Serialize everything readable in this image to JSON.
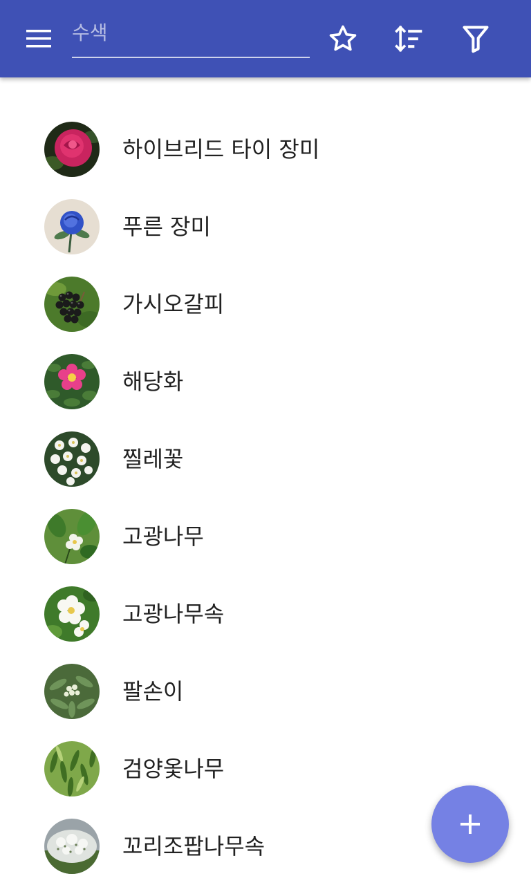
{
  "app_bar": {
    "menu_icon": "hamburger-menu-icon",
    "search_placeholder": "수색",
    "search_value": "",
    "actions": [
      "star-icon",
      "sort-icon",
      "filter-icon"
    ],
    "background_color": "#3f51b5"
  },
  "plants": [
    {
      "name": "하이브리드 타이 장미",
      "thumbnail": "pink-rose-photo"
    },
    {
      "name": "푸른 장미",
      "thumbnail": "blue-rose-photo"
    },
    {
      "name": "가시오갈피",
      "thumbnail": "black-berries-photo"
    },
    {
      "name": "해당화",
      "thumbnail": "pink-wild-rose-photo"
    },
    {
      "name": "찔레꽃",
      "thumbnail": "white-blossoms-photo"
    },
    {
      "name": "고광나무",
      "thumbnail": "white-flowers-leaves-photo"
    },
    {
      "name": "고광나무속",
      "thumbnail": "white-flowers-closeup-photo"
    },
    {
      "name": "팔손이",
      "thumbnail": "palmate-shrub-photo"
    },
    {
      "name": "검양옻나무",
      "thumbnail": "green-foliage-photo"
    },
    {
      "name": "꼬리조팝나무속",
      "thumbnail": "white-flowering-bush-photo"
    }
  ],
  "fab": {
    "icon": "plus-icon",
    "color": "#7581e4"
  }
}
